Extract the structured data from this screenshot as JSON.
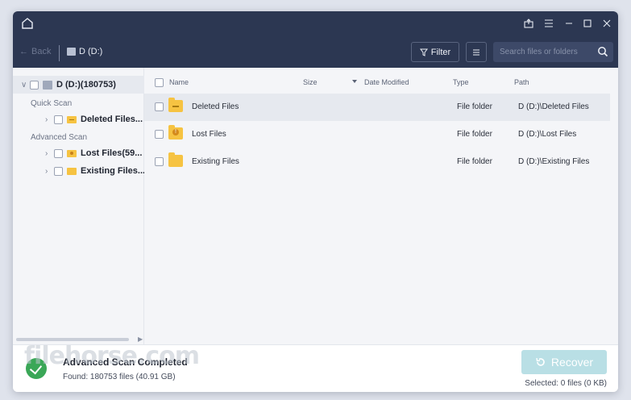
{
  "header": {
    "home_icon": "home-icon",
    "window_controls": [
      "export-icon",
      "menu-icon",
      "maximize-icon",
      "close-icon"
    ],
    "back_label": "Back",
    "breadcrumb": "D (D:)",
    "filter_label": "Filter",
    "search_placeholder": "Search files or folders"
  },
  "sidebar": {
    "root_label": "D (D:)(180753)",
    "quick_scan_label": "Quick Scan",
    "advanced_scan_label": "Advanced Scan",
    "items": [
      {
        "label": "Deleted Files..."
      },
      {
        "label": "Lost Files(59..."
      },
      {
        "label": "Existing Files..."
      }
    ]
  },
  "table": {
    "columns": {
      "name": "Name",
      "size": "Size",
      "date": "Date Modified",
      "type": "Type",
      "path": "Path"
    },
    "rows": [
      {
        "name": "Deleted Files",
        "size": "",
        "date": "",
        "type": "File folder",
        "path": "D (D:)\\Deleted Files"
      },
      {
        "name": "Lost Files",
        "size": "",
        "date": "",
        "type": "File folder",
        "path": "D (D:)\\Lost Files"
      },
      {
        "name": "Existing Files",
        "size": "",
        "date": "",
        "type": "File folder",
        "path": "D (D:)\\Existing Files"
      }
    ]
  },
  "footer": {
    "status_title": "Advanced Scan Completed",
    "status_sub": "Found: 180753 files (40.91 GB)",
    "recover_label": "Recover",
    "selected_info": "Selected: 0 files (0 KB)"
  },
  "colors": {
    "header_bg": "#2c3752",
    "folder": "#f6c342",
    "recover_disabled": "#b9dfe5",
    "success": "#3aa757"
  }
}
